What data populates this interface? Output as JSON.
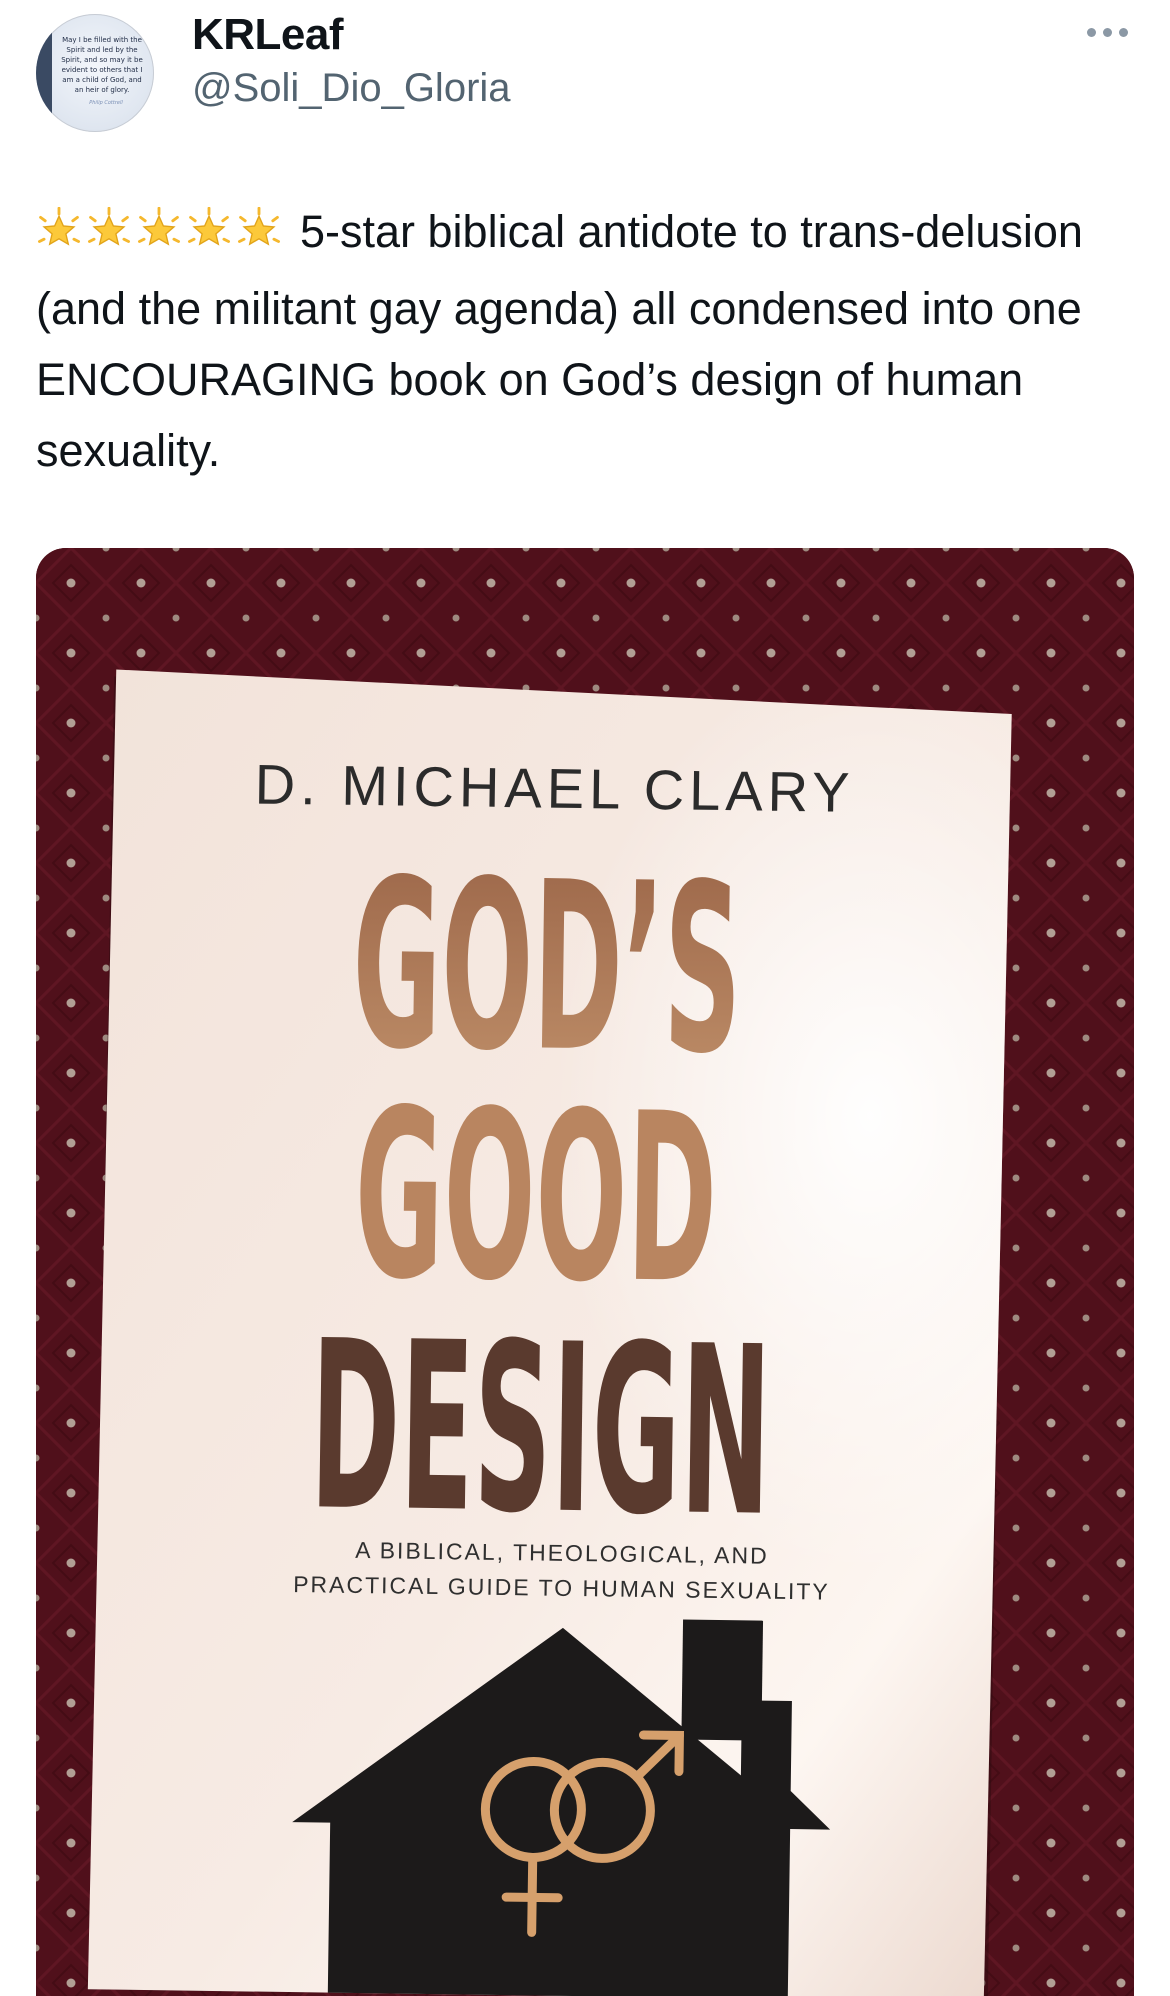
{
  "tweet": {
    "display_name": "KRLeaf",
    "handle": "@Soli_Dio_Gloria",
    "text": "5-star biblical antidote to trans-delusion (and the militant gay agenda) all condensed into one ENCOURAGING book on God’s design of human sexuality.",
    "star_icons": [
      "glowing-star-icon",
      "glowing-star-icon",
      "glowing-star-icon",
      "glowing-star-icon",
      "glowing-star-icon"
    ],
    "more_icon": "more-dots-icon"
  },
  "avatar_text": {
    "lines": [
      "May I be filled with the",
      "Spirit and led by the",
      "Spirit, and so may it be",
      "evident to others that I",
      "am a child of God, and",
      "an heir of glory."
    ],
    "signature": "Philip Cottrell"
  },
  "book": {
    "author": "D. MICHAEL CLARY",
    "title_line1": "GOD’S",
    "title_line2": "GOOD",
    "title_line3": "DESIGN",
    "subtitle_line1": "A BIBLICAL, THEOLOGICAL, AND",
    "subtitle_line2": "PRACTICAL GUIDE TO HUMAN SEXUALITY"
  },
  "colors": {
    "text_primary": "#0f1419",
    "text_secondary": "#536471",
    "upholstery": "#5a1420",
    "title_brown": "#8a5a3e",
    "house": "#1c1a1a",
    "symbol_gold": "#d6a06c"
  }
}
